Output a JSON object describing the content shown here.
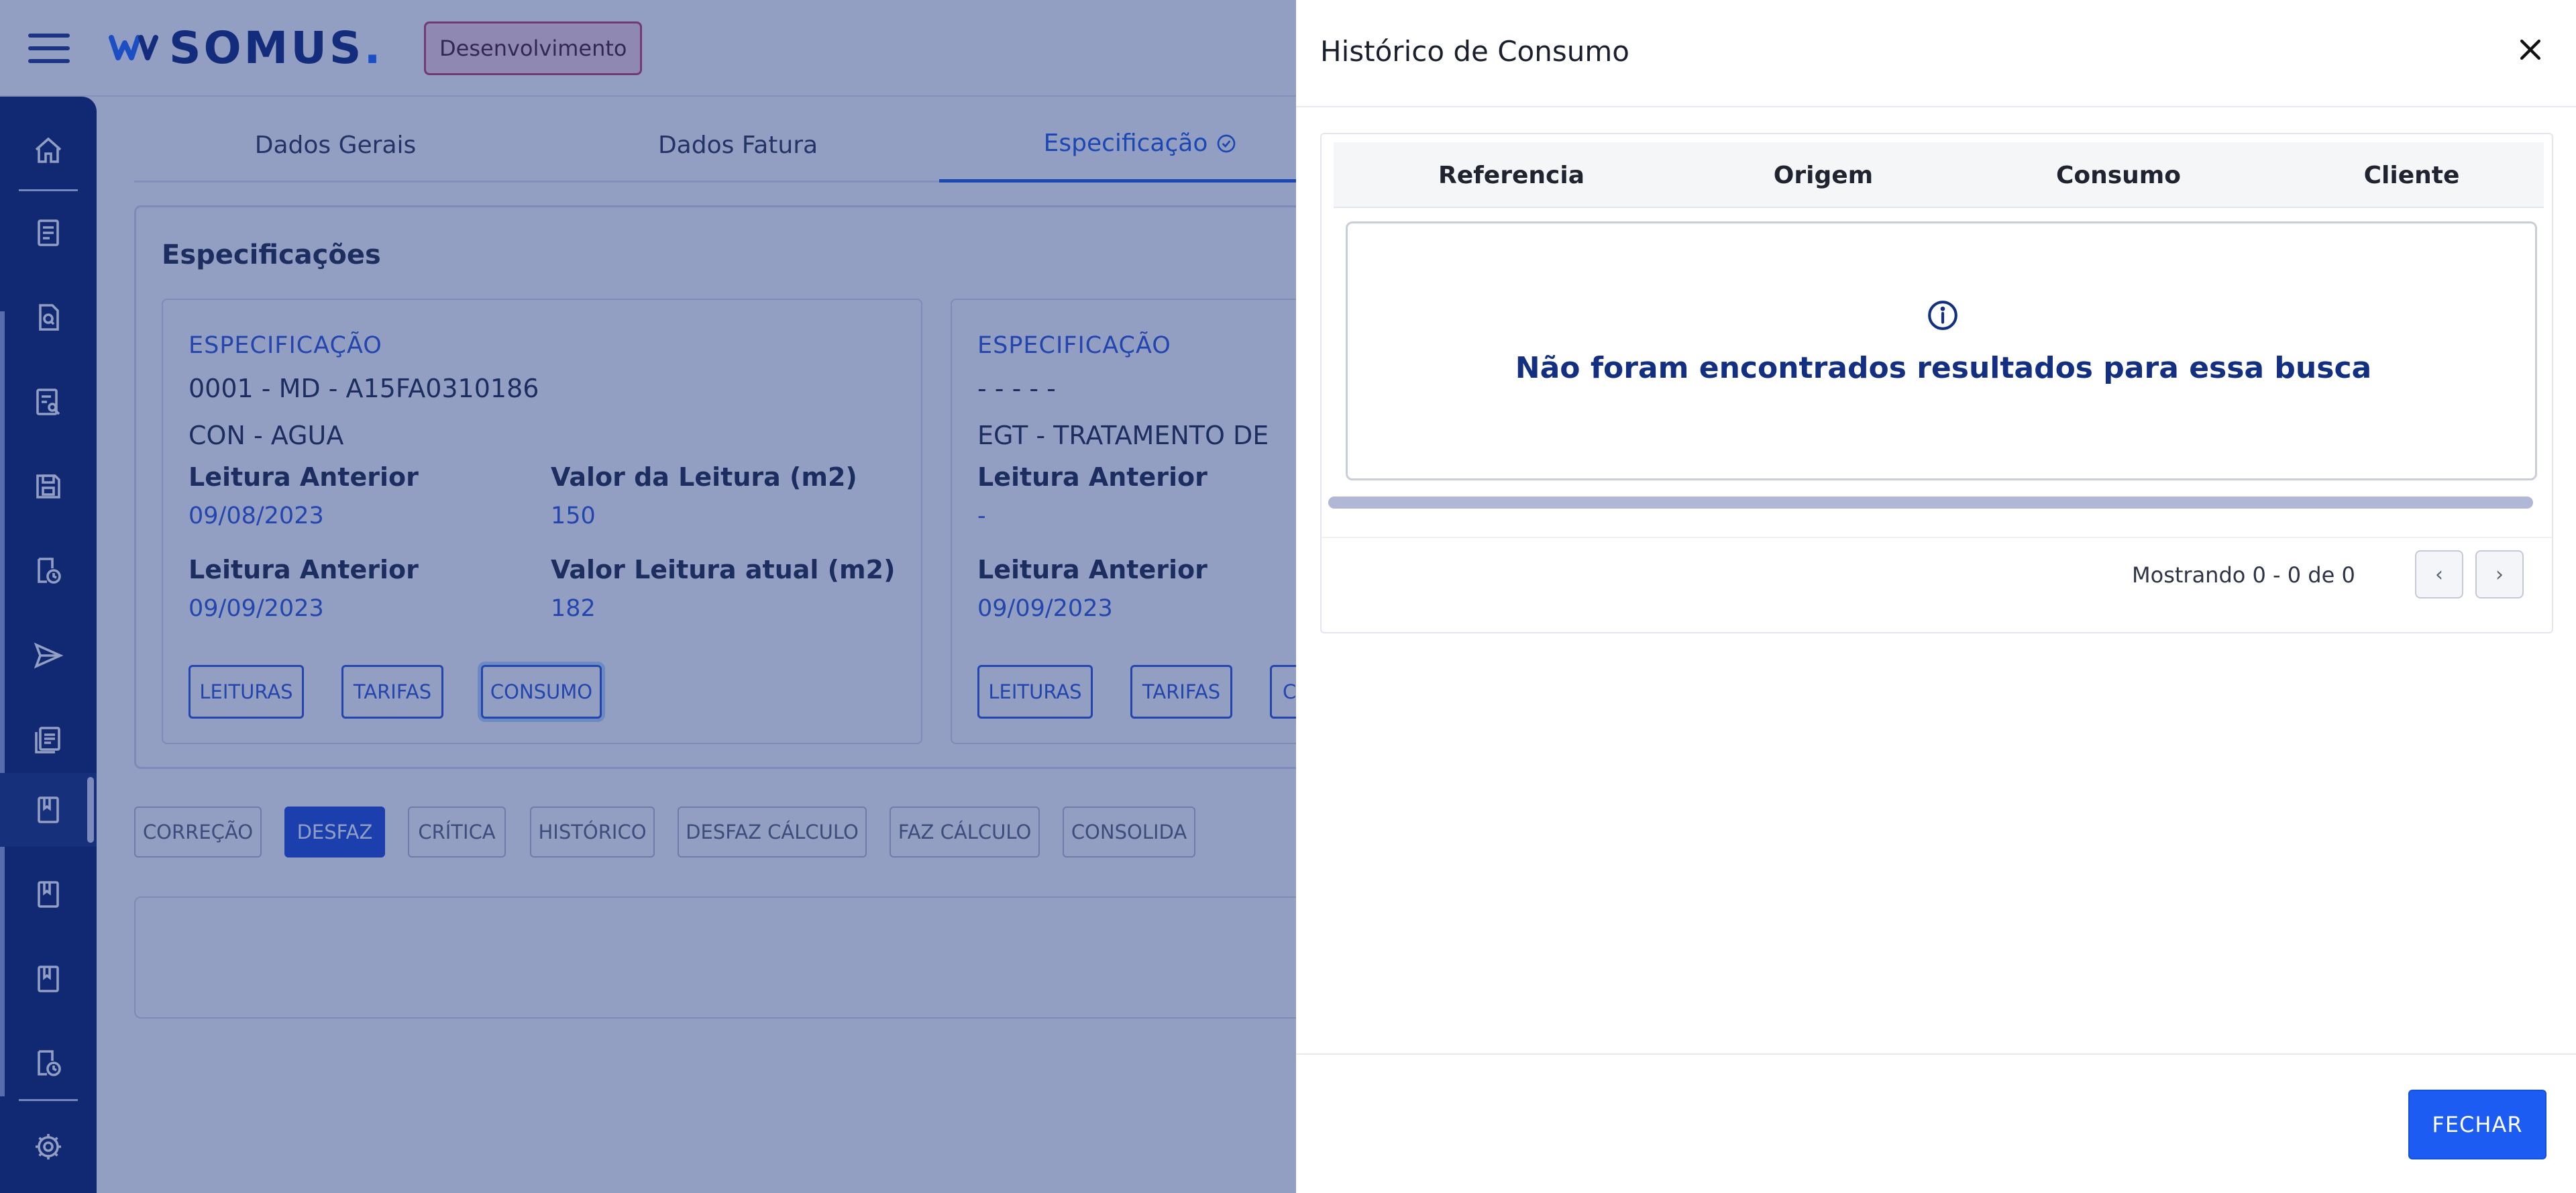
{
  "header": {
    "logo_text": "SOMUS",
    "logo_dot": ".",
    "environment_badge": "Desenvolvimento"
  },
  "tabs": [
    {
      "label": "Dados Gerais"
    },
    {
      "label": "Dados Fatura"
    },
    {
      "label": "Especificação"
    }
  ],
  "specifications": {
    "title": "Especificações",
    "cards": [
      {
        "label": "ESPECIFICAÇÃO",
        "code": "0001 - MD - A15FA0310186",
        "type": "CON - AGUA",
        "fields": [
          {
            "label": "Leitura Anterior",
            "value": "09/08/2023"
          },
          {
            "label": "Valor da Leitura (m2)",
            "value": "150"
          },
          {
            "label": "Leitura Anterior",
            "value": "09/09/2023"
          },
          {
            "label": "Valor Leitura atual (m2)",
            "value": "182"
          }
        ],
        "buttons": [
          "LEITURAS",
          "TARIFAS",
          "CONSUMO"
        ]
      },
      {
        "label": "ESPECIFICAÇÃO",
        "code": "- - - - -",
        "type": "EGT - TRATAMENTO DE",
        "fields": [
          {
            "label": "Leitura Anterior",
            "value": "-"
          },
          {
            "label": "Leitura Anterior",
            "value": "09/09/2023"
          }
        ],
        "buttons": [
          "LEITURAS",
          "TARIFAS",
          "C"
        ]
      }
    ]
  },
  "actions": [
    "CORREÇÃO",
    "DESFAZ",
    "CRÍTICA",
    "HISTÓRICO",
    "DESFAZ CÁLCULO",
    "FAZ CÁLCULO",
    "CONSOLIDA"
  ],
  "drawer": {
    "title": "Histórico de Consumo",
    "table": {
      "columns": [
        "Referencia",
        "Origem",
        "Consumo",
        "Cliente"
      ],
      "empty_message": "Não foram encontrados resultados para essa busca"
    },
    "pagination": {
      "summary": "Mostrando 0 - 0 de 0",
      "prev": "‹",
      "next": "›"
    },
    "close_label": "FECHAR"
  },
  "colors": {
    "primary": "#1d5cf2",
    "sidebar": "#0b2366",
    "overlay": "rgba(26,48,128,0.47)",
    "env_badge_border": "#c0436a"
  }
}
